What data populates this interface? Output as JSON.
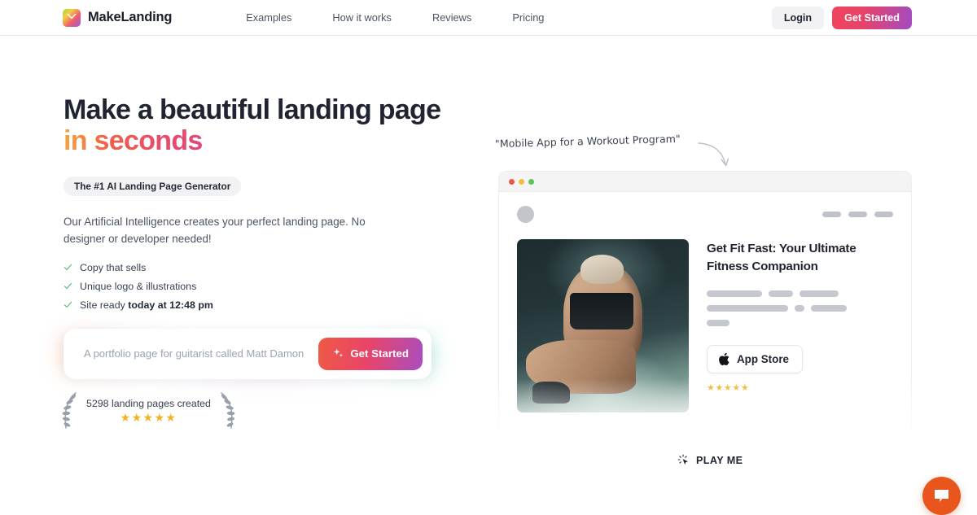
{
  "nav": {
    "brand": "MakeLanding",
    "links": [
      {
        "label": "Examples"
      },
      {
        "label": "How it works"
      },
      {
        "label": "Reviews"
      },
      {
        "label": "Pricing"
      }
    ],
    "login_label": "Login",
    "get_started_label": "Get Started"
  },
  "hero": {
    "headline_line1": "Make a beautiful landing page",
    "headline_line2": "in seconds",
    "badge": "The #1 AI Landing Page Generator",
    "subtitle": "Our Artificial Intelligence creates your perfect landing page. No designer or developer needed!",
    "checklist": [
      {
        "text": "Copy that sells",
        "bold": ""
      },
      {
        "text": "Unique logo & illustrations",
        "bold": ""
      },
      {
        "text": "Site ready ",
        "bold": "today at 12:48 pm"
      }
    ],
    "input_placeholder": "A portfolio page for guitarist called Matt Damon",
    "input_value": "",
    "cta_label": "Get Started",
    "cta_icon": "sparkles-icon"
  },
  "social_proof": {
    "count_text": "5298 landing pages created",
    "stars": "★★★★★",
    "left_icon": "laurel-wreath-left-icon",
    "right_icon": "laurel-wreath-right-icon"
  },
  "preview": {
    "annotation": "\"Mobile App for a Workout Program\"",
    "annotation_arrow_icon": "curved-arrow-icon",
    "window_dots": [
      {
        "name": "close-dot",
        "color": "#f0564a"
      },
      {
        "name": "minimize-dot",
        "color": "#f2bd3e"
      },
      {
        "name": "maximize-dot",
        "color": "#5cc45c"
      }
    ],
    "avatar_icon": "avatar-placeholder-icon",
    "nav_pills": [
      {
        "w": 23
      },
      {
        "w": 23
      },
      {
        "w": 23
      }
    ],
    "photo_alt": "woman doing sit-ups in gym",
    "title": "Get Fit Fast: Your Ultimate Fitness Companion",
    "text_bars": [
      [
        {
          "w": 68
        },
        {
          "w": 30
        },
        {
          "w": 48
        }
      ],
      [
        {
          "w": 100
        },
        {
          "w": 12
        },
        {
          "w": 44
        }
      ],
      [
        {
          "w": 28
        }
      ]
    ],
    "appstore_label": "App Store",
    "appstore_icon": "apple-icon",
    "stars": "★★★★★",
    "play_label": "PLAY ME",
    "play_icon": "click-cursor-icon"
  },
  "chat": {
    "icon": "chat-bubble-icon"
  },
  "colors": {
    "accent_start": "#f0455c",
    "accent_end": "#a24bc4",
    "gradient_text_start": "#f0a640",
    "gradient_text_end": "#e0487b",
    "check_green": "#5fbf7f",
    "star_gold": "#f0b323",
    "chat_orange": "#e8561d"
  }
}
